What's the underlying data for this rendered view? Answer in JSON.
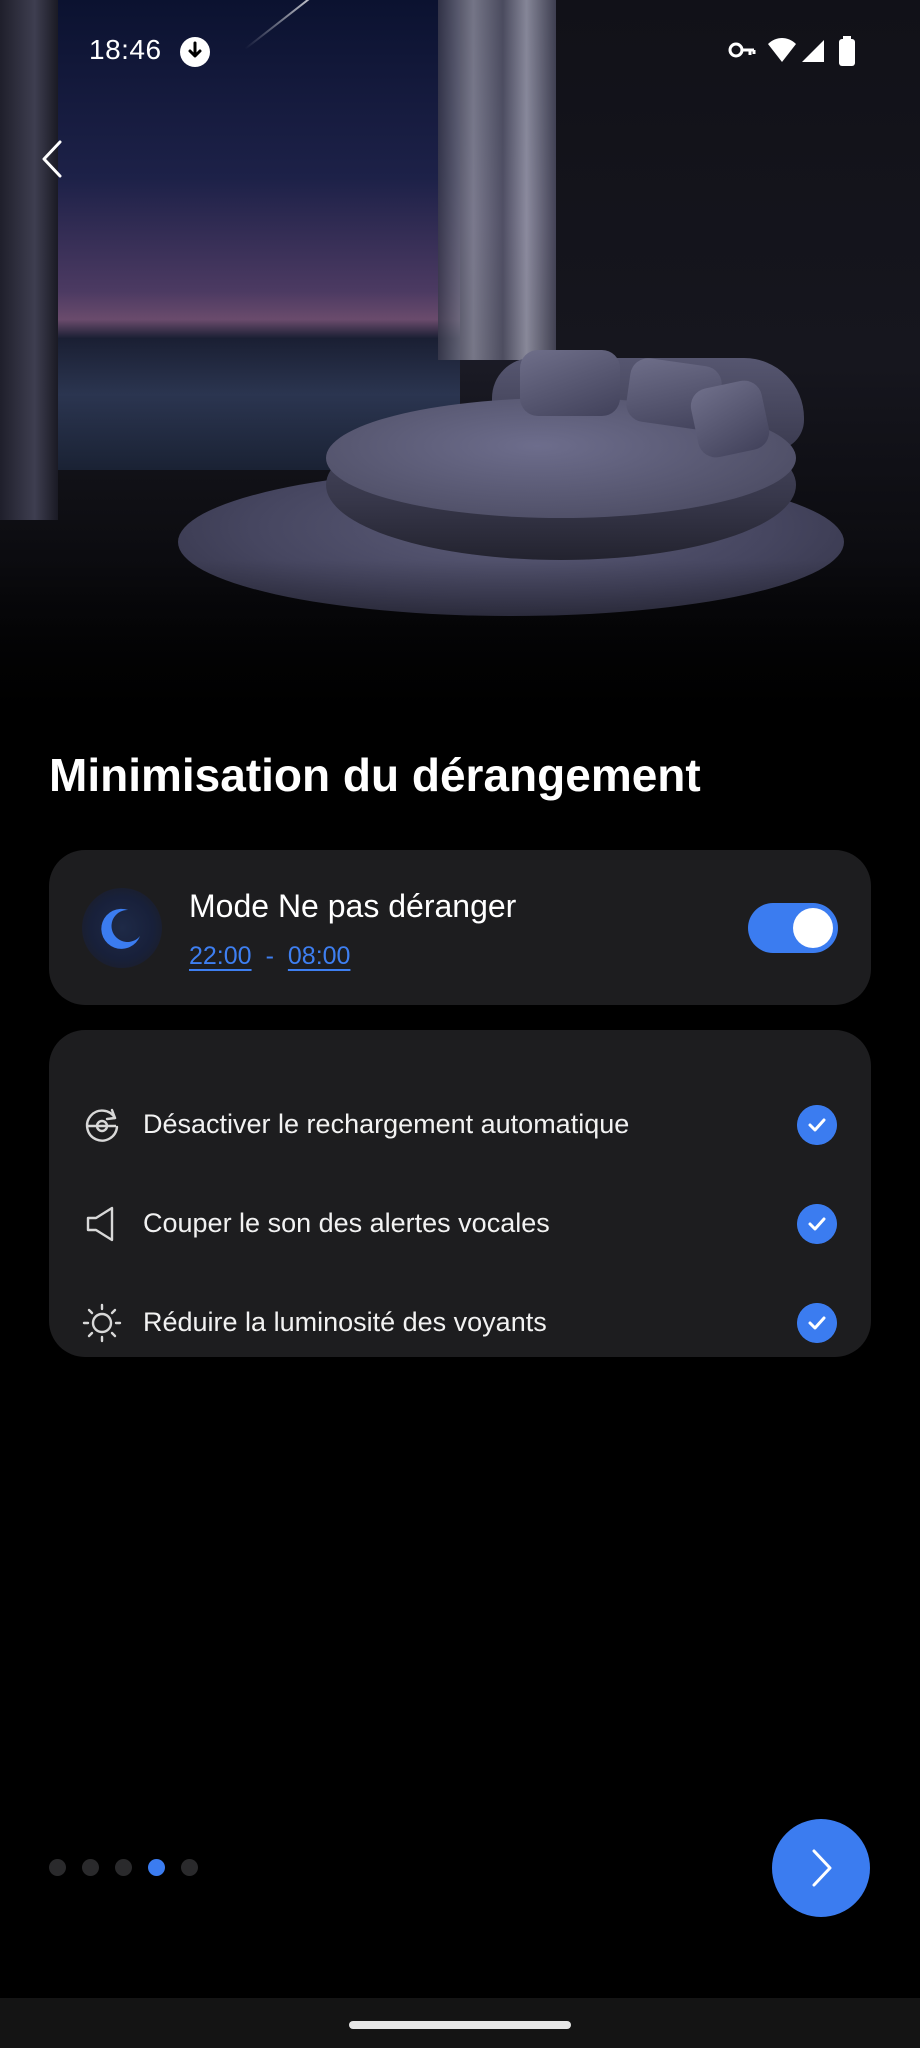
{
  "status_bar": {
    "time": "18:46",
    "icons": [
      "download-status-icon",
      "vpn-key-icon",
      "wifi-icon",
      "cellular-signal-icon",
      "battery-icon"
    ]
  },
  "header": {
    "back_icon": "chevron-left-icon"
  },
  "hero_image": {
    "description_icon": "round-bed-night-scene"
  },
  "page": {
    "title": "Minimisation du dérangement"
  },
  "dnd": {
    "icon": "moon-icon",
    "title": "Mode Ne pas déranger",
    "start_time": "22:00",
    "separator": "-",
    "end_time": "08:00",
    "enabled": true
  },
  "features": {
    "items": [
      {
        "icon": "auto-recharge-icon",
        "label": "Désactiver le rechargement automatique",
        "checked": true
      },
      {
        "icon": "speaker-icon",
        "label": "Couper le son des alertes vocales",
        "checked": true
      },
      {
        "icon": "brightness-icon",
        "label": "Réduire la luminosité des voyants",
        "checked": true
      }
    ]
  },
  "pagination": {
    "total": 5,
    "current_index": 3
  },
  "next_button": {
    "icon": "chevron-right-icon"
  },
  "colors": {
    "accent": "#3b7cf0",
    "card_bg": "#1d1d1f",
    "background": "#000000"
  }
}
